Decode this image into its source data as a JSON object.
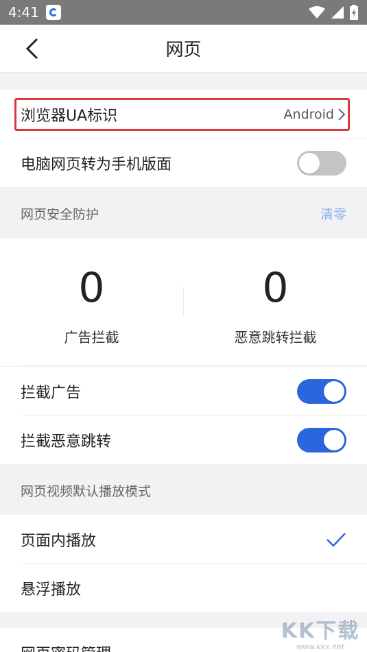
{
  "status_bar": {
    "time": "4:41"
  },
  "header": {
    "title": "网页"
  },
  "ua_row": {
    "label": "浏览器UA标识",
    "value": "Android"
  },
  "pc_to_mobile": {
    "label": "电脑网页转为手机版面",
    "enabled": false
  },
  "security": {
    "header": "网页安全防护",
    "clear_label": "清零",
    "stats": [
      {
        "value": "0",
        "label": "广告拦截"
      },
      {
        "value": "0",
        "label": "恶意跳转拦截"
      }
    ],
    "block_ads": {
      "label": "拦截广告",
      "enabled": true
    },
    "block_redirect": {
      "label": "拦截恶意跳转",
      "enabled": true
    }
  },
  "video": {
    "header": "网页视频默认播放模式",
    "options": [
      {
        "label": "页面内播放",
        "selected": true
      },
      {
        "label": "悬浮播放",
        "selected": false
      }
    ]
  },
  "password_row": {
    "label": "网页密码管理"
  },
  "watermark": {
    "main": "KK下载",
    "sub": "www.kkx.net"
  },
  "colors": {
    "accent": "#2c66dd",
    "highlight": "#d93a3a",
    "link": "#8fb0e8"
  }
}
